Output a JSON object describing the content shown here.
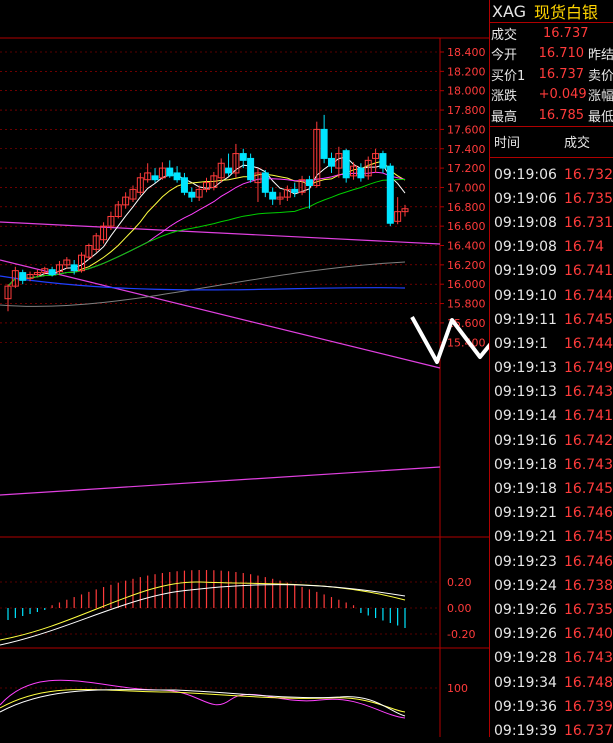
{
  "header": {
    "symbol": "XAG",
    "name": "现货白银"
  },
  "quote": [
    {
      "label": "成交",
      "value": "16.737",
      "extra": ""
    },
    {
      "label": "今开",
      "value": "16.710",
      "extra": "昨结"
    },
    {
      "label": "买价1",
      "value": "16.737",
      "extra": "卖价"
    },
    {
      "label": "涨跌",
      "value": "+0.049",
      "extra": "涨幅"
    },
    {
      "label": "最高",
      "value": "16.785",
      "extra": "最低"
    }
  ],
  "trades_header": {
    "time": "时间",
    "price": "成交"
  },
  "trades": [
    {
      "time": "09:19:06",
      "price": "16.732"
    },
    {
      "time": "09:19:06",
      "price": "16.735"
    },
    {
      "time": "09:19:08",
      "price": "16.731"
    },
    {
      "time": "09:19:08",
      "price": "16.74"
    },
    {
      "time": "09:19:09",
      "price": "16.741"
    },
    {
      "time": "09:19:10",
      "price": "16.744"
    },
    {
      "time": "09:19:11",
      "price": "16.745"
    },
    {
      "time": "09:19:1",
      "price": "16.744"
    },
    {
      "time": "09:19:13",
      "price": "16.749"
    },
    {
      "time": "09:19:13",
      "price": "16.743"
    },
    {
      "time": "09:19:14",
      "price": "16.741"
    },
    {
      "time": "09:19:16",
      "price": "16.742"
    },
    {
      "time": "09:19:18",
      "price": "16.743"
    },
    {
      "time": "09:19:18",
      "price": "16.745"
    },
    {
      "time": "09:19:21",
      "price": "16.746"
    },
    {
      "time": "09:19:21",
      "price": "16.745"
    },
    {
      "time": "09:19:23",
      "price": "16.746"
    },
    {
      "time": "09:19:24",
      "price": "16.738"
    },
    {
      "time": "09:19:26",
      "price": "16.735"
    },
    {
      "time": "09:19:26",
      "price": "16.740"
    },
    {
      "time": "09:19:28",
      "price": "16.743"
    },
    {
      "time": "09:19:34",
      "price": "16.748"
    },
    {
      "time": "09:19:36",
      "price": "16.739"
    },
    {
      "time": "09:19:39",
      "price": "16.737"
    }
  ],
  "chart": {
    "price_ticks": [
      "18.400",
      "18.200",
      "18.000",
      "17.800",
      "17.600",
      "17.400",
      "17.200",
      "17.000",
      "16.800",
      "16.600",
      "16.400",
      "16.200",
      "16.000",
      "15.800",
      "15.600",
      "15.400"
    ],
    "macd_ticks": [
      "0.20",
      "0.00",
      "-0.20"
    ],
    "kdj_ticks": [
      "100"
    ],
    "colors": {
      "up": "#ff3b3b",
      "down": "#00e5ff",
      "grid": "#b00000",
      "ma5": "#ffffff",
      "ma10": "#ffff40",
      "ma20": "#ff40ff",
      "ma40": "#00d000",
      "ma60": "#808080",
      "ma120": "#2040ff",
      "trend": "#e040e0",
      "arrow": "#ffffff"
    },
    "candles": [
      {
        "o": 15.85,
        "c": 15.98,
        "h": 16.0,
        "l": 15.72
      },
      {
        "o": 15.98,
        "c": 16.14,
        "h": 16.18,
        "l": 15.96
      },
      {
        "o": 16.12,
        "c": 16.04,
        "h": 16.15,
        "l": 16.0
      },
      {
        "o": 16.06,
        "c": 16.1,
        "h": 16.13,
        "l": 16.03
      },
      {
        "o": 16.1,
        "c": 16.12,
        "h": 16.15,
        "l": 16.08
      },
      {
        "o": 16.12,
        "c": 16.16,
        "h": 16.18,
        "l": 16.1
      },
      {
        "o": 16.15,
        "c": 16.1,
        "h": 16.18,
        "l": 16.08
      },
      {
        "o": 16.13,
        "c": 16.2,
        "h": 16.24,
        "l": 16.1
      },
      {
        "o": 16.2,
        "c": 16.25,
        "h": 16.28,
        "l": 16.16
      },
      {
        "o": 16.2,
        "c": 16.14,
        "h": 16.25,
        "l": 16.1
      },
      {
        "o": 16.14,
        "c": 16.3,
        "h": 16.33,
        "l": 16.12
      },
      {
        "o": 16.28,
        "c": 16.4,
        "h": 16.42,
        "l": 16.25
      },
      {
        "o": 16.36,
        "c": 16.5,
        "h": 16.53,
        "l": 16.33
      },
      {
        "o": 16.46,
        "c": 16.6,
        "h": 16.64,
        "l": 16.42
      },
      {
        "o": 16.6,
        "c": 16.7,
        "h": 16.75,
        "l": 16.56
      },
      {
        "o": 16.7,
        "c": 16.82,
        "h": 16.86,
        "l": 16.68
      },
      {
        "o": 16.82,
        "c": 16.9,
        "h": 16.95,
        "l": 16.78
      },
      {
        "o": 16.88,
        "c": 16.98,
        "h": 17.02,
        "l": 16.85
      },
      {
        "o": 16.95,
        "c": 17.1,
        "h": 17.15,
        "l": 16.92
      },
      {
        "o": 17.08,
        "c": 17.15,
        "h": 17.25,
        "l": 17.05
      },
      {
        "o": 17.12,
        "c": 17.08,
        "h": 17.2,
        "l": 17.05
      },
      {
        "o": 17.1,
        "c": 17.2,
        "h": 17.26,
        "l": 17.08
      },
      {
        "o": 17.2,
        "c": 17.12,
        "h": 17.28,
        "l": 17.1
      },
      {
        "o": 17.15,
        "c": 17.08,
        "h": 17.22,
        "l": 17.05
      },
      {
        "o": 17.1,
        "c": 16.95,
        "h": 17.15,
        "l": 16.92
      },
      {
        "o": 16.95,
        "c": 16.9,
        "h": 17.0,
        "l": 16.85
      },
      {
        "o": 16.9,
        "c": 16.98,
        "h": 17.02,
        "l": 16.86
      },
      {
        "o": 16.98,
        "c": 17.05,
        "h": 17.1,
        "l": 16.95
      },
      {
        "o": 17.0,
        "c": 17.12,
        "h": 17.16,
        "l": 16.97
      },
      {
        "o": 17.1,
        "c": 17.25,
        "h": 17.3,
        "l": 17.05
      },
      {
        "o": 17.2,
        "c": 17.15,
        "h": 17.35,
        "l": 17.12
      },
      {
        "o": 17.15,
        "c": 17.35,
        "h": 17.45,
        "l": 17.1
      },
      {
        "o": 17.35,
        "c": 17.28,
        "h": 17.4,
        "l": 17.2
      },
      {
        "o": 17.3,
        "c": 17.08,
        "h": 17.35,
        "l": 17.05
      },
      {
        "o": 17.05,
        "c": 17.15,
        "h": 17.2,
        "l": 16.85
      },
      {
        "o": 17.15,
        "c": 16.95,
        "h": 17.18,
        "l": 16.9
      },
      {
        "o": 16.95,
        "c": 16.88,
        "h": 17.0,
        "l": 16.82
      },
      {
        "o": 16.88,
        "c": 16.9,
        "h": 16.95,
        "l": 16.82
      },
      {
        "o": 16.9,
        "c": 16.98,
        "h": 17.02,
        "l": 16.86
      },
      {
        "o": 16.98,
        "c": 16.95,
        "h": 17.05,
        "l": 16.9
      },
      {
        "o": 16.95,
        "c": 17.08,
        "h": 17.12,
        "l": 16.92
      },
      {
        "o": 17.08,
        "c": 17.02,
        "h": 17.12,
        "l": 16.78
      },
      {
        "o": 17.02,
        "c": 17.6,
        "h": 17.68,
        "l": 17.0
      },
      {
        "o": 17.6,
        "c": 17.3,
        "h": 17.75,
        "l": 17.25
      },
      {
        "o": 17.3,
        "c": 17.22,
        "h": 17.36,
        "l": 17.15
      },
      {
        "o": 17.2,
        "c": 17.35,
        "h": 17.42,
        "l": 17.1
      },
      {
        "o": 17.38,
        "c": 17.1,
        "h": 17.4,
        "l": 17.05
      },
      {
        "o": 17.12,
        "c": 17.22,
        "h": 17.26,
        "l": 17.08
      },
      {
        "o": 17.2,
        "c": 17.1,
        "h": 17.25,
        "l": 17.06
      },
      {
        "o": 17.12,
        "c": 17.28,
        "h": 17.32,
        "l": 17.08
      },
      {
        "o": 17.3,
        "c": 17.35,
        "h": 17.4,
        "l": 17.15
      },
      {
        "o": 17.35,
        "c": 17.2,
        "h": 17.38,
        "l": 17.15
      },
      {
        "o": 17.22,
        "c": 16.63,
        "h": 17.25,
        "l": 16.6
      },
      {
        "o": 16.65,
        "c": 16.75,
        "h": 16.9,
        "l": 16.62
      },
      {
        "o": 16.75,
        "c": 16.78,
        "h": 16.82,
        "l": 16.7
      }
    ]
  }
}
